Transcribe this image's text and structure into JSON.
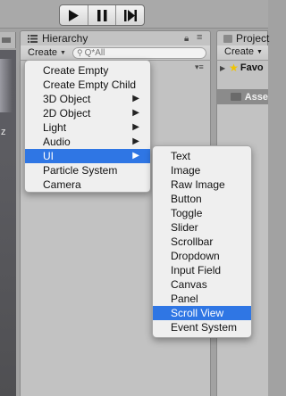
{
  "toolbar": {
    "buttons": [
      {
        "name": "play-icon"
      },
      {
        "name": "pause-icon"
      },
      {
        "name": "step-icon"
      }
    ]
  },
  "scene": {
    "axis_label": "z"
  },
  "hierarchy": {
    "tab_label": "Hierarchy",
    "create_label": "Create",
    "search_placeholder": "Q*All"
  },
  "project": {
    "tab_label": "Project",
    "create_label": "Create",
    "favorites_label": "Favo",
    "assets_label": "Asse"
  },
  "create_menu": {
    "items": [
      {
        "label": "Create Empty",
        "submenu": false,
        "selected": false
      },
      {
        "label": "Create Empty Child",
        "submenu": false,
        "selected": false
      },
      {
        "label": "3D Object",
        "submenu": true,
        "selected": false
      },
      {
        "label": "2D Object",
        "submenu": true,
        "selected": false
      },
      {
        "label": "Light",
        "submenu": true,
        "selected": false
      },
      {
        "label": "Audio",
        "submenu": true,
        "selected": false
      },
      {
        "label": "UI",
        "submenu": true,
        "selected": true
      },
      {
        "label": "Particle System",
        "submenu": false,
        "selected": false
      },
      {
        "label": "Camera",
        "submenu": false,
        "selected": false
      }
    ]
  },
  "ui_submenu": {
    "items": [
      {
        "label": "Text",
        "selected": false
      },
      {
        "label": "Image",
        "selected": false
      },
      {
        "label": "Raw Image",
        "selected": false
      },
      {
        "label": "Button",
        "selected": false
      },
      {
        "label": "Toggle",
        "selected": false
      },
      {
        "label": "Slider",
        "selected": false
      },
      {
        "label": "Scrollbar",
        "selected": false
      },
      {
        "label": "Dropdown",
        "selected": false
      },
      {
        "label": "Input Field",
        "selected": false
      },
      {
        "label": "Canvas",
        "selected": false
      },
      {
        "label": "Panel",
        "selected": false
      },
      {
        "label": "Scroll View",
        "selected": true
      },
      {
        "label": "Event System",
        "selected": false
      }
    ]
  },
  "colors": {
    "selection": "#2f76e4",
    "favorite_star": "#f0c400"
  }
}
